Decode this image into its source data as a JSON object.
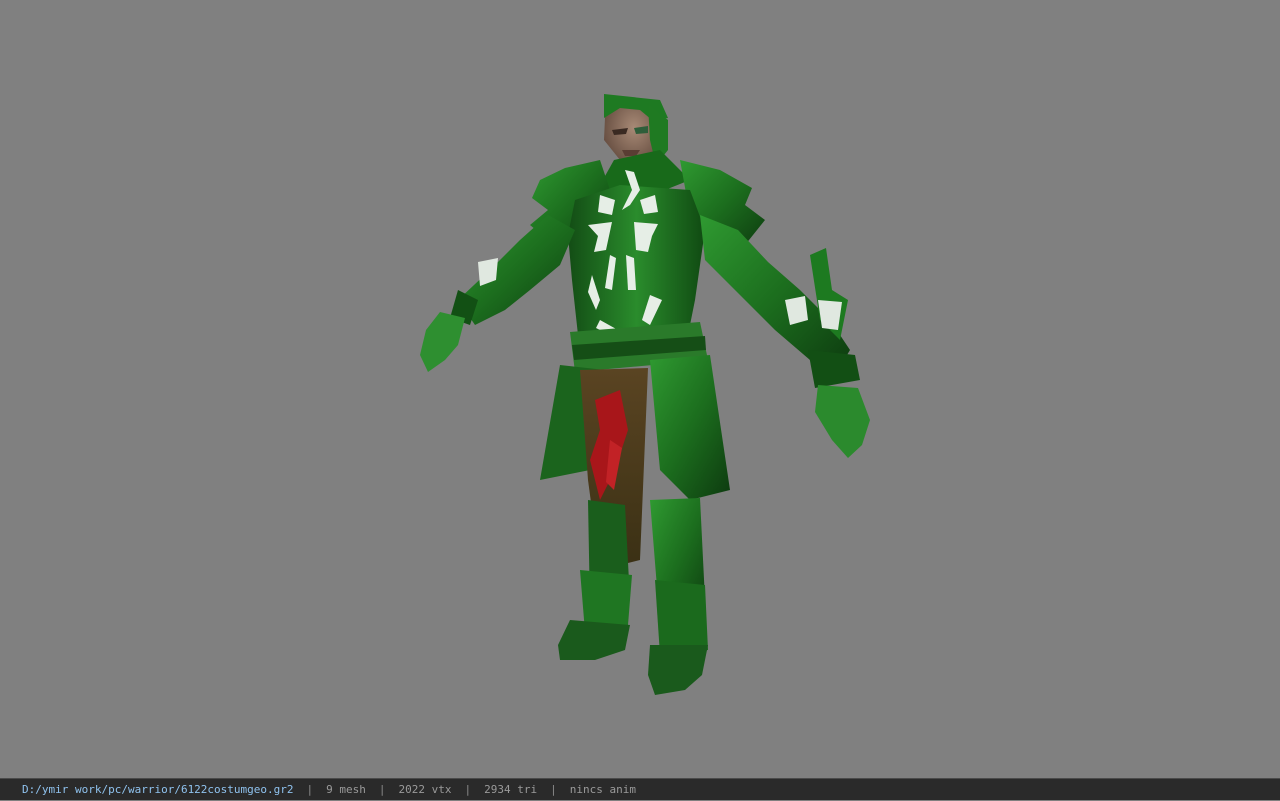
{
  "viewport": {
    "background": "#808080",
    "model_subject": "green-armored-warrior-model"
  },
  "statusbar": {
    "file_path": "D:/ymir work/pc/warrior/6122costumgeo.gr2",
    "separator": "|",
    "mesh_count": "9 mesh",
    "vertex_count": "2022 vtx",
    "triangle_count": "2934 tri",
    "anim_status": "nincs anim"
  },
  "colors": {
    "armor": "#1f7a22",
    "armor_dark": "#0e3f10",
    "armor_light": "#3ea83f",
    "rune_white": "#e8f0e8",
    "cloth": "#4a3a1c",
    "cloth_red": "#b0161a",
    "skin": "#9c7a68",
    "path_blue": "#8fc2ee"
  }
}
